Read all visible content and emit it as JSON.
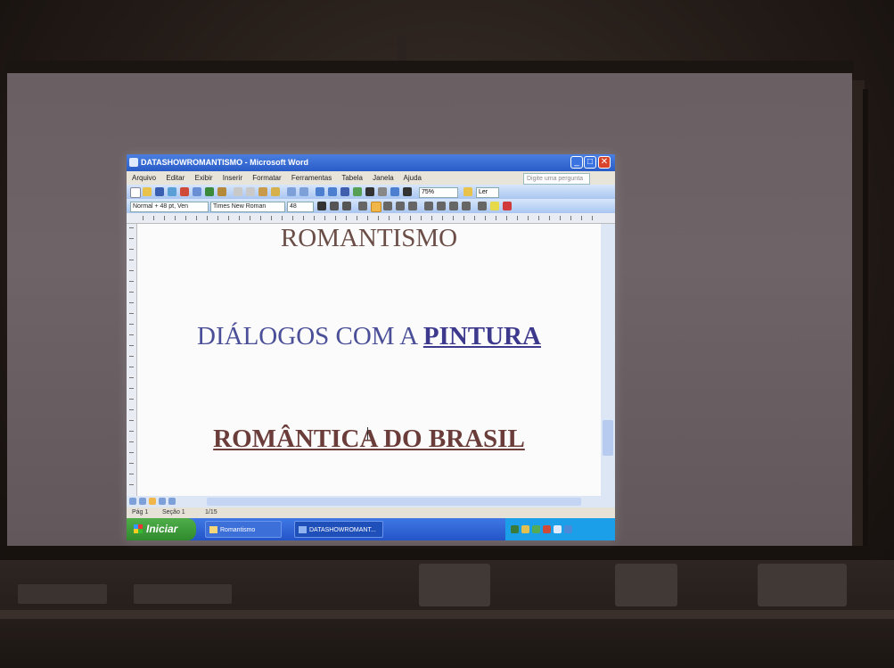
{
  "window": {
    "title": "DATASHOWROMANTISMO - Microsoft Word",
    "help_placeholder": "Digite uma pergunta",
    "minimize": "_",
    "maximize": "□",
    "close": "✕"
  },
  "menu": {
    "items": [
      "Arquivo",
      "Editar",
      "Exibir",
      "Inserir",
      "Formatar",
      "Ferramentas",
      "Tabela",
      "Janela",
      "Ajuda"
    ]
  },
  "toolbar": {
    "zoom": "75%",
    "read_label": "Ler",
    "style": "Normal + 48 pt, Ven",
    "font": "Times New Roman",
    "size": "48"
  },
  "document": {
    "line1": "ROMANTISMO",
    "line2_prefix": "DIÁLOGOS COM A ",
    "line2_emphasis": "PINTURA",
    "line3": "ROMÂNTICA DO BRASIL"
  },
  "statusbar": {
    "page": "Pág 1",
    "section": "Seção 1",
    "count": "1/15"
  },
  "taskbar": {
    "start": "Iniciar",
    "task1": "Romantismo",
    "task2": "DATASHOWROMANT..."
  },
  "colors": {
    "title_blue": "#2a5cc8",
    "start_green": "#2f8a2c",
    "line1": "#6b4e47",
    "line2": "#4a4f97",
    "line3": "#6b3d3a"
  }
}
